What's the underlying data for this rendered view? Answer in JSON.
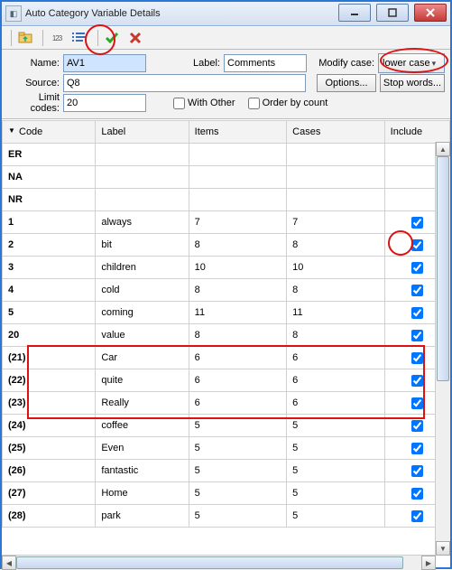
{
  "window_title": "Auto Category Variable Details",
  "toolbar": {
    "icons": [
      "up-folder",
      "numbers-mode",
      "word-mode",
      "accept",
      "cancel"
    ]
  },
  "fields": {
    "name_label": "Name:",
    "name_value": "AV1",
    "label_label": "Label:",
    "label_value": "Comments",
    "modifycase_label": "Modify case:",
    "modifycase_value": "lower case",
    "source_label": "Source:",
    "source_value": "Q8",
    "options_btn": "Options...",
    "stopwords_btn": "Stop words...",
    "limitcodes_label": "Limit codes:",
    "limitcodes_value": "20",
    "withother_label": "With Other",
    "orderbycount_label": "Order by count"
  },
  "grid": {
    "headers": {
      "code": "Code",
      "label": "Label",
      "items": "Items",
      "cases": "Cases",
      "include": "Include"
    },
    "fixed_rows": [
      "ER",
      "NA",
      "NR"
    ],
    "rows": [
      {
        "code": "1",
        "label": "always",
        "items": "7",
        "cases": "7",
        "include": true
      },
      {
        "code": "2",
        "label": "bit",
        "items": "8",
        "cases": "8",
        "include": true,
        "circled": true
      },
      {
        "code": "3",
        "label": "children",
        "items": "10",
        "cases": "10",
        "include": true
      },
      {
        "code": "4",
        "label": "cold",
        "items": "8",
        "cases": "8",
        "include": true
      },
      {
        "code": "5",
        "label": "coming",
        "items": "11",
        "cases": "11",
        "include": true
      },
      {
        "code": "20",
        "label": "value",
        "items": "8",
        "cases": "8",
        "include": true
      },
      {
        "code": "(21)",
        "label": "Car",
        "items": "6",
        "cases": "6",
        "include": true
      },
      {
        "code": "(22)",
        "label": "quite",
        "items": "6",
        "cases": "6",
        "include": true
      },
      {
        "code": "(23)",
        "label": "Really",
        "items": "6",
        "cases": "6",
        "include": true
      },
      {
        "code": "(24)",
        "label": "coffee",
        "items": "5",
        "cases": "5",
        "include": true
      },
      {
        "code": "(25)",
        "label": "Even",
        "items": "5",
        "cases": "5",
        "include": true
      },
      {
        "code": "(26)",
        "label": "fantastic",
        "items": "5",
        "cases": "5",
        "include": true
      },
      {
        "code": "(27)",
        "label": "Home",
        "items": "5",
        "cases": "5",
        "include": true
      },
      {
        "code": "(28)",
        "label": "park",
        "items": "5",
        "cases": "5",
        "include": true
      }
    ]
  }
}
